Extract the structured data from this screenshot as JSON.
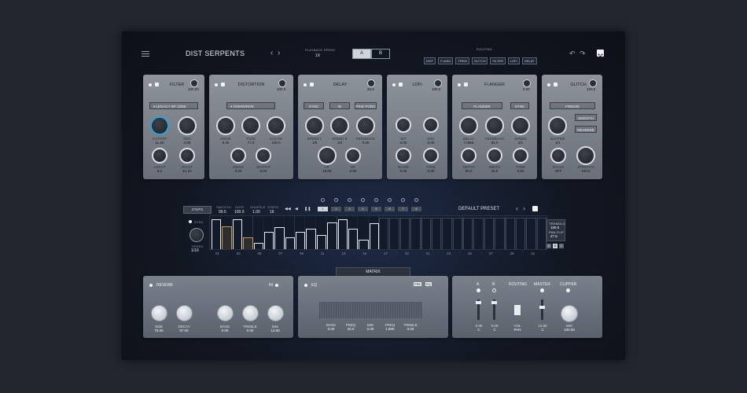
{
  "header": {
    "preset_name": "DIST SERPENTS",
    "playback_speed_label": "PLAYBACK SPEED",
    "playback_speed_value": "1X",
    "ab": [
      "A",
      "B"
    ],
    "routing_label": "ROUTING",
    "routing": [
      "DIST",
      "FLANG",
      "TREM",
      "GLITCH",
      "FILTER",
      "LOFI",
      "DELAY"
    ]
  },
  "modules": {
    "filter": {
      "title": "FILTER",
      "mini_value": "100.00",
      "dropdown": "LEGACY BP 12DB",
      "knobs": [
        {
          "label": "CUTOFF",
          "value": "11.4K"
        },
        {
          "label": "RES",
          "value": "3.80"
        },
        {
          "label": "LOCUT",
          "value": "8.2"
        },
        {
          "label": "HICUT",
          "value": "21.1K"
        }
      ]
    },
    "distortion": {
      "title": "DISTORTION",
      "mini_value": "100.0",
      "dropdown": "OVERDRIVE",
      "knobs": [
        {
          "label": "DRIVE",
          "value": "8.40"
        },
        {
          "label": "FUZZ",
          "value": "77.0"
        },
        {
          "label": "COLOR",
          "value": "100.0"
        },
        {
          "label": "MONO",
          "value": "0.00"
        },
        {
          "label": "OUTPUT",
          "value": "0.00"
        }
      ]
    },
    "delay": {
      "title": "DELAY",
      "mini_value": "35.5",
      "buttons": [
        "SYNC",
        "IN",
        "PING PONG"
      ],
      "knobs": [
        {
          "label": "SPEED L",
          "value": "1/8"
        },
        {
          "label": "SPEED R",
          "value": "1/4"
        },
        {
          "label": "FEEDBACK",
          "value": "0.00"
        },
        {
          "label": "LP",
          "value": "18.0K"
        },
        {
          "label": "BP",
          "value": "0.00"
        }
      ]
    },
    "lofi": {
      "title": "LOFI",
      "mini_value": "100.0",
      "knobs": [
        {
          "label": "BIT",
          "value": "0.00"
        },
        {
          "label": "SRC",
          "value": "0.00"
        },
        {
          "label": "NOISE",
          "value": "0.00"
        },
        {
          "label": "TONE",
          "value": "0.00"
        }
      ]
    },
    "flanger": {
      "title": "FLANGER",
      "mini_value": "0.00",
      "buttons": [
        "FLANGER",
        "SYNC"
      ],
      "knobs": [
        {
          "label": "DELAY",
          "value": "7.0MS"
        },
        {
          "label": "FEEDBACK",
          "value": "85.0"
        },
        {
          "label": "SPEED",
          "value": "2/1"
        },
        {
          "label": "DEPTH",
          "value": "90.0"
        },
        {
          "label": "WIDTH",
          "value": "15.0"
        },
        {
          "label": "TONE",
          "value": "0.00"
        }
      ]
    },
    "glitch": {
      "title": "GLITCH",
      "mini_value": "100.0",
      "buttons": [
        "FREEZE",
        "SMOOTH",
        "REVERSE"
      ],
      "knobs": [
        {
          "label": "BUFFER",
          "value": "1/4"
        },
        {
          "label": "SCALE",
          "value": "OFF"
        },
        {
          "label": "STRETCH",
          "value": "100.0"
        }
      ]
    }
  },
  "sequencer": {
    "steps_button": "STEPS",
    "params": [
      {
        "label": "SMOOTH",
        "value": "99.5"
      },
      {
        "label": "GATE",
        "value": "100.0"
      },
      {
        "label": "SHUFFLE",
        "value": "1.00"
      },
      {
        "label": "STEPS",
        "value": "16"
      }
    ],
    "transport": [
      "◀◀",
      "◀",
      "❚❚"
    ],
    "step_buttons": [
      "1",
      "2",
      "3",
      "4",
      "5",
      "6",
      "7",
      "8"
    ],
    "preset": "DEFAULT PRESET",
    "sync_label": "SYNC",
    "speed_label": "SPEED",
    "speed_value": "1/16",
    "right_labels": [
      {
        "label": "TREMOLO",
        "value": "100.0"
      },
      {
        "label": "PAN FLIP",
        "value": "27.5"
      }
    ],
    "bars": [
      0.95,
      0.72,
      0.95,
      0.38,
      0.2,
      0.55,
      0.7,
      0.38,
      0.55,
      0.65,
      0.45,
      0.85,
      0.95,
      0.65,
      0.3,
      0.82
    ],
    "bar_colors": [
      "w",
      "o",
      "w",
      "o",
      "w",
      "w",
      "w",
      "w",
      "w",
      "w",
      "w",
      "w",
      "w",
      "w",
      "w",
      "w"
    ],
    "x_ticks": [
      "01",
      "03",
      "05",
      "07",
      "09",
      "11",
      "13",
      "15",
      "17",
      "19",
      "21",
      "23",
      "25",
      "27",
      "29",
      "31"
    ],
    "mini_buttons": [
      "A",
      "B",
      "C"
    ]
  },
  "matrix_tab": "MATRIX",
  "reverb": {
    "title": "REVERB",
    "in_label": "IN",
    "knobs": [
      {
        "label": "SIZE",
        "value": "75.00"
      },
      {
        "label": "DECAY",
        "value": "87.00"
      },
      {
        "label": "BASS",
        "value": "0.00"
      },
      {
        "label": "TREBLE",
        "value": "0.00"
      },
      {
        "label": "MIX",
        "value": "14.00"
      }
    ]
  },
  "eq": {
    "title": "EQ",
    "badges": [
      "PRE",
      "EQ"
    ],
    "knobs": [
      {
        "label": "BASS",
        "value": "0.00"
      },
      {
        "label": "FREQ",
        "value": "20.0"
      },
      {
        "label": "MID",
        "value": "0.00"
      },
      {
        "label": "FREQ",
        "value": "1.89K"
      },
      {
        "label": "TREBLE",
        "value": "0.00"
      }
    ]
  },
  "master": {
    "labels": [
      "A",
      "B",
      "ROUTING",
      "MASTER",
      "CLIPPER"
    ],
    "faders": [
      {
        "label": "0.00",
        "value": "C"
      },
      {
        "label": "0.00",
        "value": "C"
      },
      {
        "label": "VOL",
        "value": "PAN"
      },
      {
        "label": "12.00",
        "value": "C"
      }
    ],
    "mix": {
      "label": "MIX",
      "value": "100.00"
    }
  },
  "colors": {
    "accent": "#2fa4d8",
    "card": "#8d929b",
    "panel": "#6b717c",
    "seq_orange": "#c79a55",
    "background": "#22262e"
  }
}
